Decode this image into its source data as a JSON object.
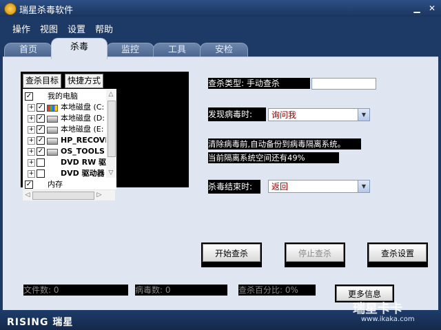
{
  "window": {
    "title": "瑞星杀毒软件",
    "minimize": "▁",
    "close": "✕"
  },
  "menu": [
    "操作",
    "视图",
    "设置",
    "帮助"
  ],
  "tabs": [
    "首页",
    "杀毒",
    "监控",
    "工具",
    "安检"
  ],
  "target": {
    "tab_labels": [
      "查杀目标",
      "快捷方式"
    ],
    "tree": [
      {
        "label": "我的电脑",
        "checked": true,
        "expander": "",
        "bold": false,
        "icon": ""
      },
      {
        "label": "本地磁盘 (C:",
        "checked": true,
        "expander": "+",
        "bold": false,
        "icon": "windows-drive-icon"
      },
      {
        "label": "本地磁盘 (D:",
        "checked": true,
        "expander": "+",
        "bold": false,
        "icon": "drive-icon"
      },
      {
        "label": "本地磁盘 (E:",
        "checked": true,
        "expander": "+",
        "bold": false,
        "icon": "drive-icon"
      },
      {
        "label": "HP_RECOVER",
        "checked": true,
        "expander": "+",
        "bold": true,
        "icon": "drive-icon"
      },
      {
        "label": "OS_TOOLS (G",
        "checked": true,
        "expander": "+",
        "bold": true,
        "icon": "drive-icon"
      },
      {
        "label": "DVD RW 驱动",
        "checked": false,
        "expander": "+",
        "bold": true,
        "icon": ""
      },
      {
        "label": "DVD 驱动器 (",
        "checked": false,
        "expander": "+",
        "bold": true,
        "icon": ""
      },
      {
        "label": "内存",
        "checked": true,
        "expander": "",
        "bold": false,
        "icon": ""
      }
    ]
  },
  "settings": {
    "scan_type_label": "查杀类型: 手动查杀",
    "found_virus_label": "发现病毒时:",
    "found_virus_value": "询问我",
    "backup_text": "清除病毒前,自动备份到病毒隔离系统。",
    "quarantine_text": "当前隔离系统空间还有49%",
    "scan_end_label": "杀毒结束时:",
    "scan_end_value": "返回"
  },
  "buttons": {
    "start": "开始查杀",
    "stop": "停止查杀",
    "scan_settings": "查杀设置",
    "more_info": "更多信息"
  },
  "status": {
    "files": "文件数: 0",
    "viruses": "病毒数: 0",
    "percent": "查杀百分比: 0%"
  },
  "footer": {
    "logo": "RISING 瑞星",
    "watermark": "瑞星卡卡",
    "watermark_url": "www.ikaka.com"
  },
  "colors": {
    "frame": "#1d3a66",
    "panel": "#dfe6f1",
    "combo_text": "#8a0000"
  }
}
